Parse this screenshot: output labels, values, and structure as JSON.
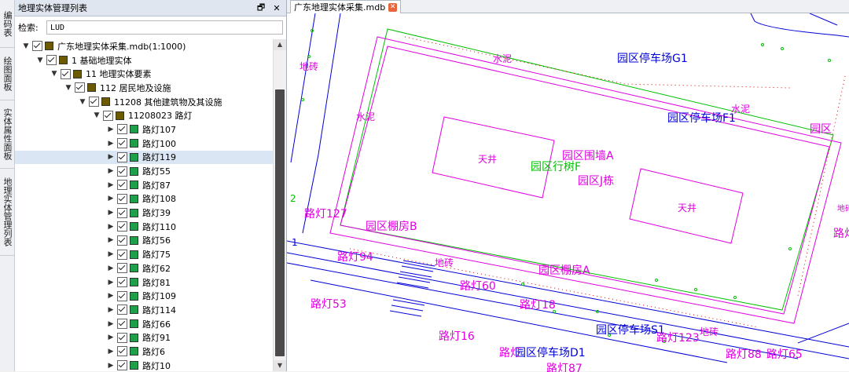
{
  "side_tabs": [
    "编码表",
    "绘图面板",
    "实体属性面板",
    "地理实体管理列表"
  ],
  "panel": {
    "title": "地理实体管理列表",
    "pin_icon": "restore-icon",
    "close_icon": "close-icon",
    "search_label": "检索:",
    "search_value": "LUD"
  },
  "tree": [
    {
      "indent": 0,
      "label": "广东地理实体采集.mdb(1:1000)",
      "expanded": true,
      "color": "#6b5a00"
    },
    {
      "indent": 1,
      "label": "1 基础地理实体",
      "expanded": true,
      "color": "#6b5a00"
    },
    {
      "indent": 2,
      "label": "11 地理实体要素",
      "expanded": true,
      "color": "#6b5a00"
    },
    {
      "indent": 3,
      "label": "112 居民地及设施",
      "expanded": true,
      "color": "#6b5a00"
    },
    {
      "indent": 4,
      "label": "11208 其他建筑物及其设施",
      "expanded": true,
      "color": "#6b5a00"
    },
    {
      "indent": 5,
      "label": "11208023 路灯",
      "expanded": true,
      "color": "#6b5a00"
    },
    {
      "indent": 6,
      "label": "路灯107",
      "expanded": false,
      "color": "#1ea04a"
    },
    {
      "indent": 6,
      "label": "路灯100",
      "expanded": false,
      "color": "#1ea04a"
    },
    {
      "indent": 6,
      "label": "路灯119",
      "expanded": false,
      "color": "#1ea04a",
      "selected": true
    },
    {
      "indent": 6,
      "label": "路灯55",
      "expanded": false,
      "color": "#1ea04a"
    },
    {
      "indent": 6,
      "label": "路灯87",
      "expanded": false,
      "color": "#1ea04a"
    },
    {
      "indent": 6,
      "label": "路灯108",
      "expanded": false,
      "color": "#1ea04a"
    },
    {
      "indent": 6,
      "label": "路灯39",
      "expanded": false,
      "color": "#1ea04a"
    },
    {
      "indent": 6,
      "label": "路灯110",
      "expanded": false,
      "color": "#1ea04a"
    },
    {
      "indent": 6,
      "label": "路灯56",
      "expanded": false,
      "color": "#1ea04a"
    },
    {
      "indent": 6,
      "label": "路灯75",
      "expanded": false,
      "color": "#1ea04a"
    },
    {
      "indent": 6,
      "label": "路灯62",
      "expanded": false,
      "color": "#1ea04a"
    },
    {
      "indent": 6,
      "label": "路灯81",
      "expanded": false,
      "color": "#1ea04a"
    },
    {
      "indent": 6,
      "label": "路灯109",
      "expanded": false,
      "color": "#1ea04a"
    },
    {
      "indent": 6,
      "label": "路灯114",
      "expanded": false,
      "color": "#1ea04a"
    },
    {
      "indent": 6,
      "label": "路灯66",
      "expanded": false,
      "color": "#1ea04a"
    },
    {
      "indent": 6,
      "label": "路灯91",
      "expanded": false,
      "color": "#1ea04a"
    },
    {
      "indent": 6,
      "label": "路灯6",
      "expanded": false,
      "color": "#1ea04a"
    },
    {
      "indent": 6,
      "label": "路灯10",
      "expanded": false,
      "color": "#1ea04a"
    }
  ],
  "doc_tab": {
    "label": "广东地理实体采集.mdb",
    "close_icon": "close-icon"
  },
  "map": {
    "colors": {
      "magenta": "#e000e0",
      "green": "#00c000",
      "blue": "#0000d8",
      "red_dot": "#e00000"
    },
    "labels": {
      "cement1": "水泥",
      "cement2": "水泥",
      "cement3": "水泥",
      "parking_g1": "园区停车场G1",
      "parking_f1": "园区停车场F1",
      "parking_s1": "园区停车场S1",
      "parking_d1": "园区停车场D1",
      "courtyard1": "天井",
      "courtyard2": "天井",
      "wall_a": "园区围墙A",
      "walkway_f": "园区行树F",
      "building_j": "园区J栋",
      "shed_b": "园区棚房B",
      "shed_a": "园区棚房A",
      "brick1": "地砖",
      "brick2": "地砖",
      "brick3": "地砖",
      "brick4": "地砖",
      "lamp127": "路灯127",
      "lamp94": "路灯94",
      "lamp60": "路灯60",
      "lamp53": "路灯53",
      "lamp18": "路灯18",
      "lamp16": "路灯16",
      "lamp123": "路灯123",
      "lamp88": "路灯88",
      "lamp65": "路灯65",
      "lamp87": "路灯87",
      "lamp_cut": "路灯",
      "garden_edge": "园区",
      "ground_edge": "地砖",
      "lamp_edge": "路灯",
      "num1": "1",
      "num2": "2"
    }
  }
}
